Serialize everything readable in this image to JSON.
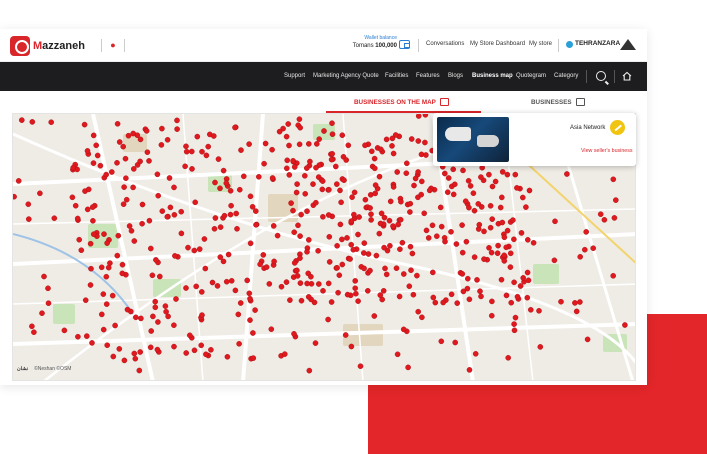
{
  "brand": {
    "name_first": "M",
    "name_rest": "azzaneh"
  },
  "wallet": {
    "label": "Wallet balance",
    "currency": "Tomans",
    "amount": "100,000"
  },
  "top_links": [
    "Conversations",
    "My Store Dashboard",
    "My store"
  ],
  "store": {
    "name": "TEHRANZARA"
  },
  "nav": {
    "items": [
      "Support",
      "Marketing Agency Quote",
      "Facilities",
      "Features",
      "Blogs",
      "Business map",
      "Quotegram",
      "Category"
    ],
    "active": "Business map"
  },
  "tabs": {
    "map": "BUSINESSES ON THE MAP",
    "list": "BUSINESSES"
  },
  "popup": {
    "business_name": "Asia Network",
    "link": "View seller's business"
  },
  "map": {
    "attribution_brand": "نشان",
    "attribution": "©Neshan ©OSM"
  },
  "colors": {
    "accent": "#d9262b",
    "navbar": "#1d1d1f",
    "link_blue": "#2a7fd1",
    "decor": "#e32629"
  }
}
